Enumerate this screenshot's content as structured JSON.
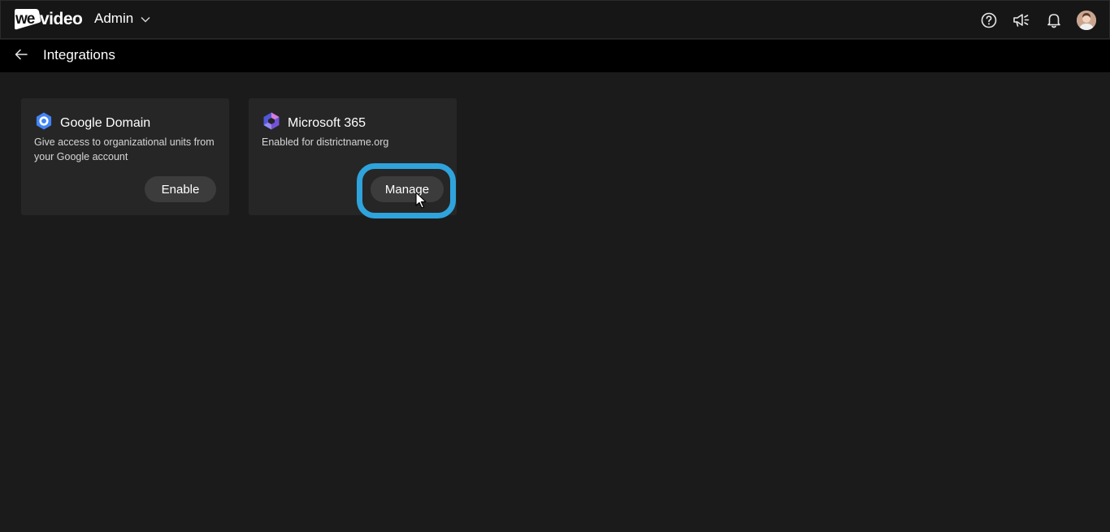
{
  "topbar": {
    "logo_we": "we",
    "logo_video": "video",
    "app_switcher_label": "Admin"
  },
  "subheader": {
    "title": "Integrations"
  },
  "integrations": [
    {
      "title": "Google Domain",
      "description": "Give access to organizational units from your Google account",
      "button_label": "Enable",
      "icon": "google-domain-icon"
    },
    {
      "title": "Microsoft 365",
      "description": "Enabled for districtname.org",
      "button_label": "Manage",
      "icon": "microsoft-365-icon"
    }
  ],
  "colors": {
    "topbar_bg": "#161616",
    "subheader_bg": "#000000",
    "content_bg": "#1b1b1b",
    "card_bg": "#262626",
    "button_bg": "#3c3c3c",
    "highlight": "#2fa3dc",
    "google_blue": "#4285f4"
  },
  "icons": [
    "help-icon",
    "announcements-icon",
    "notifications-icon",
    "avatar",
    "back-arrow-icon",
    "chevron-down-icon"
  ]
}
